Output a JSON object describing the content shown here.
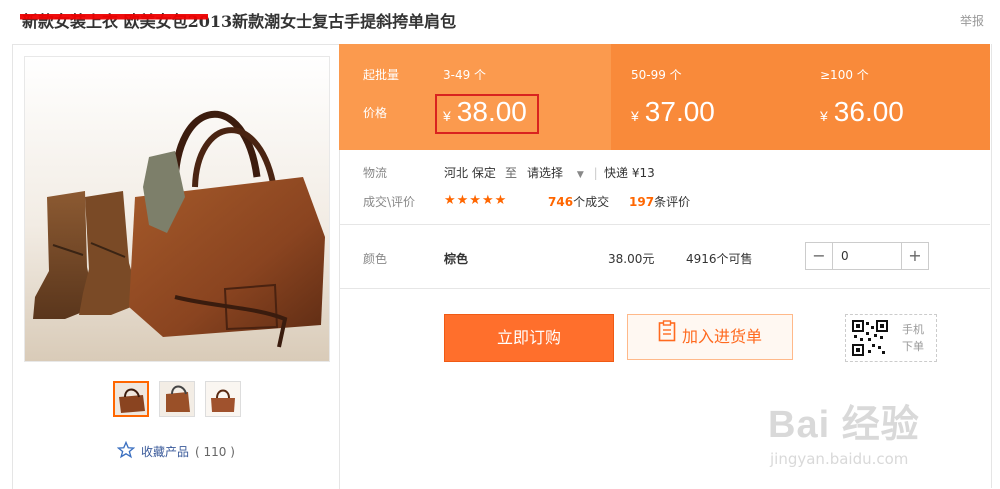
{
  "header": {
    "title": "新款女装上衣 欧美女包2013新款潮女士复古手提斜挎单肩包",
    "report": "举报"
  },
  "gallery": {
    "main_image_alt": "棕色复古手提包与靴子",
    "thumbnails": [
      "thumb-1",
      "thumb-2",
      "thumb-3"
    ],
    "favorite_label": "收藏产品",
    "favorite_count": "( 110 )"
  },
  "pricing": {
    "batch_label": "起批量",
    "price_label": "价格",
    "currency": "¥",
    "tiers": [
      {
        "range": "3-49 个",
        "price": "38.00"
      },
      {
        "range": "50-99 个",
        "price": "37.00"
      },
      {
        "range": "≥100 个",
        "price": "36.00"
      }
    ]
  },
  "logistics": {
    "label": "物流",
    "origin": "河北 保定",
    "to": "至",
    "destination": "请选择",
    "shipping": "快递 ¥13"
  },
  "reviews": {
    "label": "成交\\评价",
    "rating": 4.5,
    "deals_count": "746",
    "deals_suffix": "个成交",
    "review_count": "197",
    "review_suffix": "条评价"
  },
  "variant": {
    "label": "颜色",
    "color": "棕色",
    "price": "38.00元",
    "stock": "4916个可售",
    "quantity": "0",
    "minus": "−",
    "plus": "+"
  },
  "actions": {
    "buy_now": "立即订购",
    "add_to_list": "加入进货单",
    "mobile_line1": "手机",
    "mobile_line2": "下单"
  },
  "watermark": {
    "brand": "Bai 经验",
    "url": "jingyan.baidu.com"
  },
  "colors": {
    "accent": "#ff6f2c",
    "price_band": "#fb9a4e",
    "link": "#3a5a9a"
  }
}
